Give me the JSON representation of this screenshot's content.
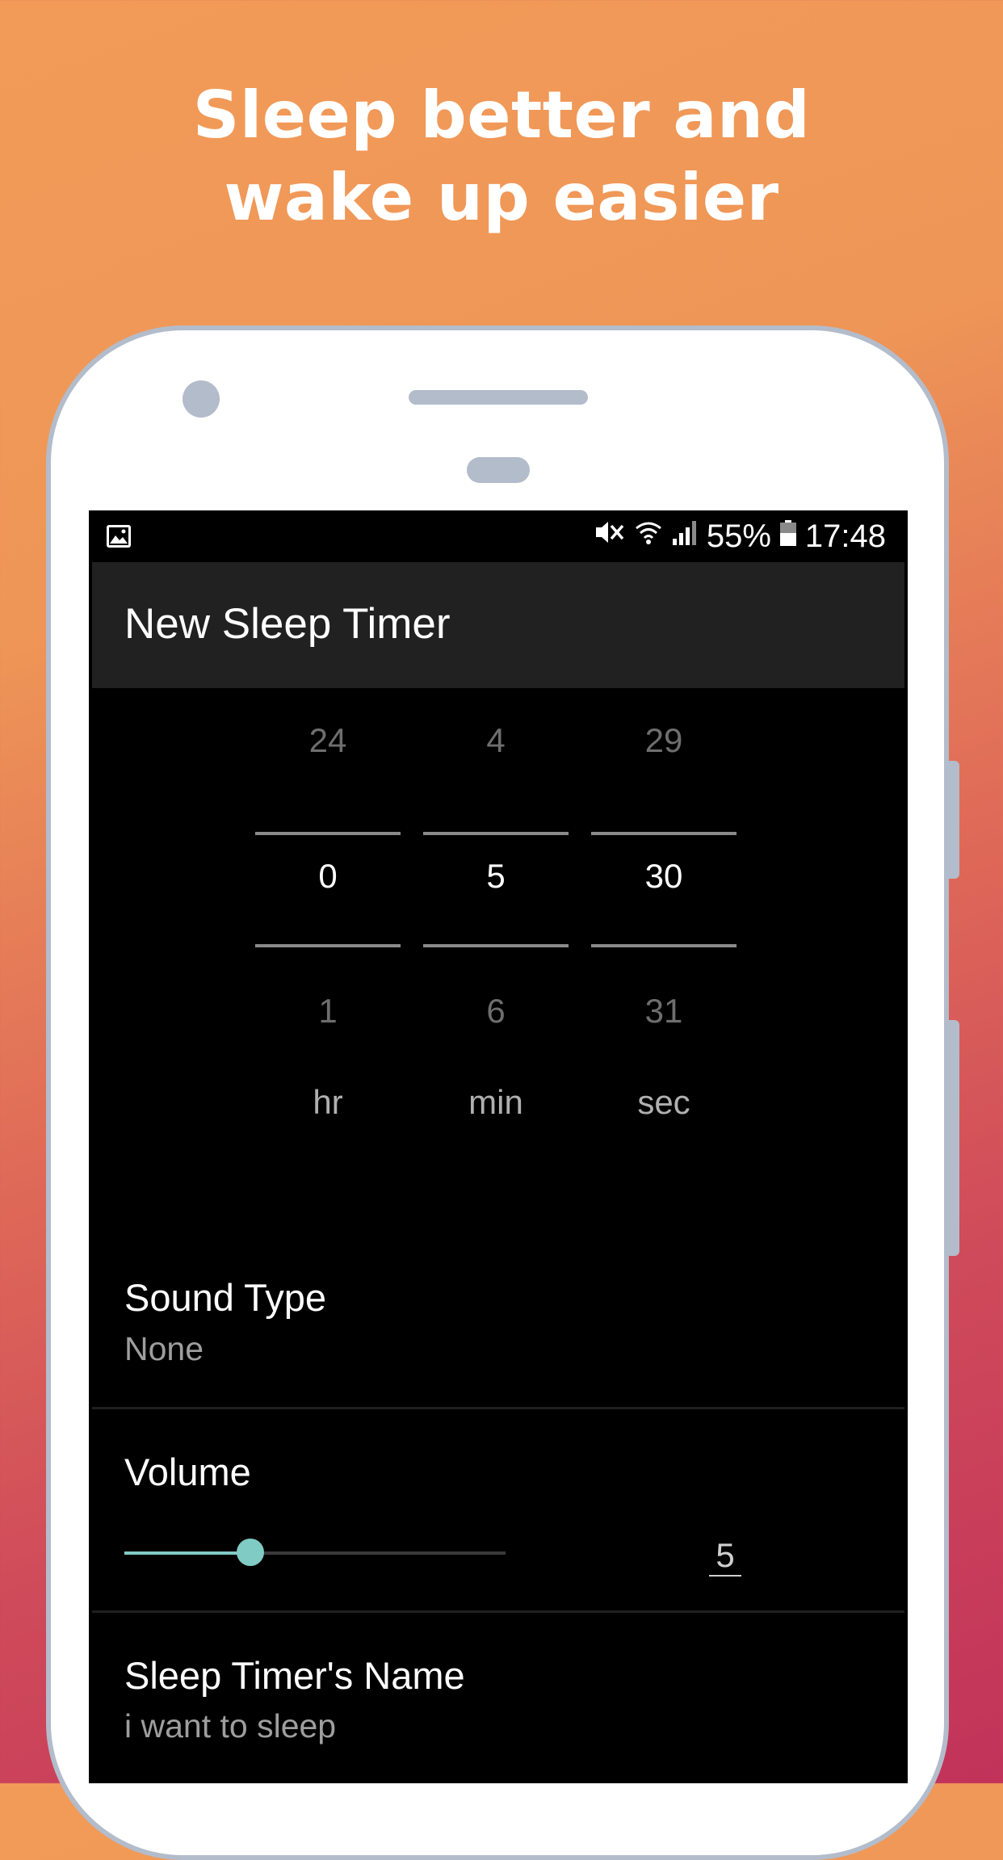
{
  "headline": {
    "line1": "Sleep better and",
    "line2": "wake up easier"
  },
  "status_bar": {
    "left_icon": "image-icon",
    "icons": [
      "mute-icon",
      "wifi-icon",
      "signal-icon",
      "battery-icon"
    ],
    "battery_percent": "55%",
    "time": "17:48"
  },
  "app_bar": {
    "title": "New Sleep Timer"
  },
  "timer": {
    "hours": {
      "prev": "24",
      "current": "0",
      "next": "1",
      "unit": "hr"
    },
    "minutes": {
      "prev": "4",
      "current": "5",
      "next": "6",
      "unit": "min"
    },
    "seconds": {
      "prev": "29",
      "current": "30",
      "next": "31",
      "unit": "sec"
    }
  },
  "settings": {
    "sound_type": {
      "title": "Sound Type",
      "value": "None"
    },
    "volume": {
      "title": "Volume",
      "value": "5",
      "level_fraction": 0.33,
      "accent_color": "#80cbc4"
    },
    "name": {
      "title": "Sleep Timer's Name",
      "value": "i want to sleep"
    }
  },
  "colors": {
    "background_top": "#f29b58",
    "background_bottom": "#c2325a",
    "app_bar": "#212121",
    "screen": "#000000"
  }
}
